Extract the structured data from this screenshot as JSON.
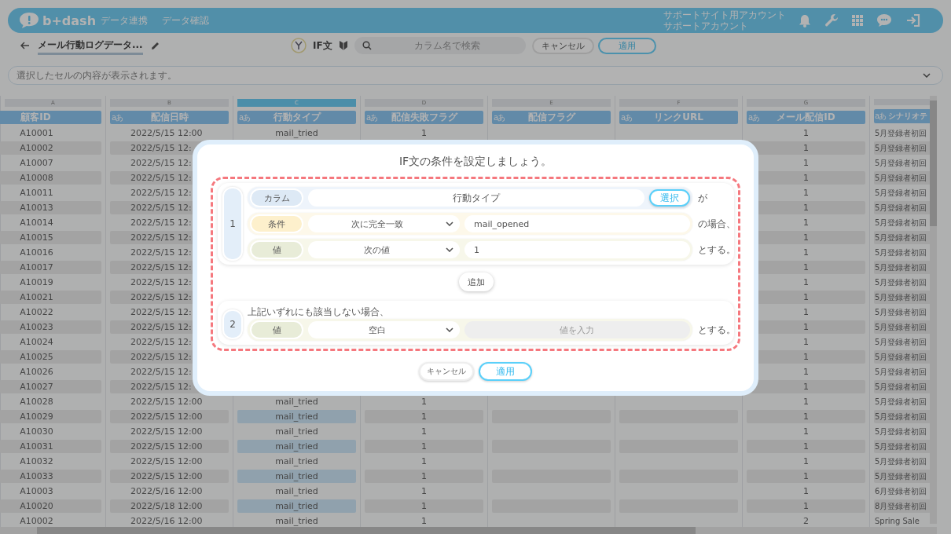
{
  "header": {
    "logo": "b+dash",
    "nav": [
      {
        "label": "データ連携"
      },
      {
        "label": "データ確認"
      }
    ],
    "account": [
      "サポートサイト用アカウント",
      "サポートアカウント"
    ]
  },
  "toolbar": {
    "title": "メール行動ログデータ...",
    "mode": "IF文",
    "search": {
      "placeholder": "カラム名で検索"
    },
    "buttons": [
      {
        "label": "キャンセル",
        "kind": "secondary"
      },
      {
        "label": "適用",
        "kind": "primary"
      }
    ]
  },
  "cell_bar": {
    "placeholder": "選択したセルの内容が表示されます。"
  },
  "table": {
    "columns": [
      {
        "letter": "A",
        "name": "顧客ID",
        "selected": false
      },
      {
        "letter": "B",
        "name": "配信日時",
        "type_badge": "aあ",
        "selected": false
      },
      {
        "letter": "C",
        "name": "行動タイプ",
        "type_badge": "aあ",
        "selected": true
      },
      {
        "letter": "D",
        "name": "配信失敗フラグ",
        "type_badge": "aあ",
        "selected": false
      },
      {
        "letter": "E",
        "name": "配信フラグ",
        "type_badge": "aあ",
        "selected": false
      },
      {
        "letter": "F",
        "name": "リンクURL",
        "type_badge": "aあ",
        "selected": false
      },
      {
        "letter": "G",
        "name": "メール配信ID",
        "type_badge": "aあ",
        "selected": false
      },
      {
        "name": "シナリオテ",
        "type_badge": "aあ",
        "selected": false
      }
    ],
    "rows": [
      {
        "id": "A10001",
        "date": "2022/5/15 12:00",
        "type": "mail_tried",
        "fail": "1",
        "mail_id": "1",
        "scenario": "5月登録者初回"
      },
      {
        "id": "A10002",
        "date": "2022/5/15 12:",
        "mail_id": "1",
        "scenario": "5月登録者初回"
      },
      {
        "id": "A10007",
        "date": "2022/5/15 12:",
        "mail_id": "1",
        "scenario": "5月登録者初回"
      },
      {
        "id": "A10008",
        "date": "2022/5/15 12:",
        "mail_id": "1",
        "scenario": "5月登録者初回"
      },
      {
        "id": "A10011",
        "date": "2022/5/15 12:",
        "mail_id": "1",
        "scenario": "5月登録者初回"
      },
      {
        "id": "A10013",
        "date": "2022/5/15 12:",
        "mail_id": "1",
        "scenario": "5月登録者初回"
      },
      {
        "id": "A10014",
        "date": "2022/5/15 12:",
        "mail_id": "1",
        "scenario": "5月登録者初回"
      },
      {
        "id": "A10015",
        "date": "2022/5/15 12:",
        "mail_id": "1",
        "scenario": "5月登録者初回"
      },
      {
        "id": "A10016",
        "date": "2022/5/15 12:",
        "mail_id": "1",
        "scenario": "5月登録者初回"
      },
      {
        "id": "A10017",
        "date": "2022/5/15 12:",
        "mail_id": "1",
        "scenario": "5月登録者初回"
      },
      {
        "id": "A10019",
        "date": "2022/5/15 12:",
        "mail_id": "1",
        "scenario": "5月登録者初回"
      },
      {
        "id": "A10021",
        "date": "2022/5/15 12:",
        "mail_id": "1",
        "scenario": "5月登録者初回"
      },
      {
        "id": "A10022",
        "date": "2022/5/15 12:",
        "mail_id": "1",
        "scenario": "5月登録者初回"
      },
      {
        "id": "A10023",
        "date": "2022/5/15 12:",
        "mail_id": "1",
        "scenario": "5月登録者初回"
      },
      {
        "id": "A10024",
        "date": "2022/5/15 12:",
        "mail_id": "1",
        "scenario": "5月登録者初回"
      },
      {
        "id": "A10025",
        "date": "2022/5/15 12:",
        "mail_id": "1",
        "scenario": "5月登録者初回"
      },
      {
        "id": "A10026",
        "date": "2022/5/15 12:",
        "mail_id": "1",
        "scenario": "5月登録者初回"
      },
      {
        "id": "A10027",
        "date": "2022/5/15 12:",
        "mail_id": "1",
        "scenario": "5月登録者初回"
      },
      {
        "id": "A10028",
        "date": "2022/5/15 12:00",
        "type": "mail_tried",
        "fail": "1",
        "mail_id": "1",
        "scenario": "5月登録者初回"
      },
      {
        "id": "A10029",
        "date": "2022/5/15 12:00",
        "type": "mail_tried",
        "fail": "1",
        "mail_id": "1",
        "scenario": "5月登録者初回"
      },
      {
        "id": "A10030",
        "date": "2022/5/15 12:00",
        "type": "mail_tried",
        "fail": "1",
        "mail_id": "1",
        "scenario": "5月登録者初回"
      },
      {
        "id": "A10031",
        "date": "2022/5/15 12:00",
        "type": "mail_tried",
        "fail": "1",
        "mail_id": "1",
        "scenario": "5月登録者初回"
      },
      {
        "id": "A10032",
        "date": "2022/5/15 12:00",
        "type": "mail_tried",
        "fail": "1",
        "mail_id": "1",
        "scenario": "5月登録者初回"
      },
      {
        "id": "A10033",
        "date": "2022/5/15 12:00",
        "type": "mail_tried",
        "fail": "1",
        "mail_id": "1",
        "scenario": "5月登録者初回"
      },
      {
        "id": "A10003",
        "date": "2022/5/16 12:00",
        "type": "mail_tried",
        "fail": "1",
        "mail_id": "1",
        "scenario": "6月登録者初回"
      },
      {
        "id": "A10020",
        "date": "2022/5/18 12:00",
        "type": "mail_tried",
        "fail": "1",
        "mail_id": "1",
        "scenario": "8月登録者初回"
      },
      {
        "id": "A10002",
        "date": "2022/5/16 12:00",
        "type": "mail_tried",
        "fail": "1",
        "mail_id": "2",
        "scenario": "Spring Sale"
      }
    ]
  },
  "modal": {
    "title": "IF文の条件を設定しましょう。",
    "conditions": [
      {
        "number": "1",
        "rows": [
          {
            "kind": "column",
            "label": "カラム",
            "value": "行動タイプ",
            "button": "選択",
            "suffix": "が"
          },
          {
            "kind": "condition",
            "label": "条件",
            "select": "次に完全一致",
            "value": "mail_opened",
            "suffix": "の場合、"
          },
          {
            "kind": "value",
            "label": "値",
            "select": "次の値",
            "value": "1",
            "suffix": "とする。"
          }
        ]
      }
    ],
    "add_button": "追加",
    "else": {
      "number": "2",
      "text": "上記いずれにも該当しない場合、",
      "rows": [
        {
          "kind": "value",
          "label": "値",
          "select": "空白",
          "placeholder": "値を入力",
          "disabled": true,
          "suffix": "とする。"
        }
      ]
    },
    "buttons": [
      {
        "label": "キャンセル",
        "kind": "secondary"
      },
      {
        "label": "適用",
        "kind": "primary"
      }
    ]
  }
}
